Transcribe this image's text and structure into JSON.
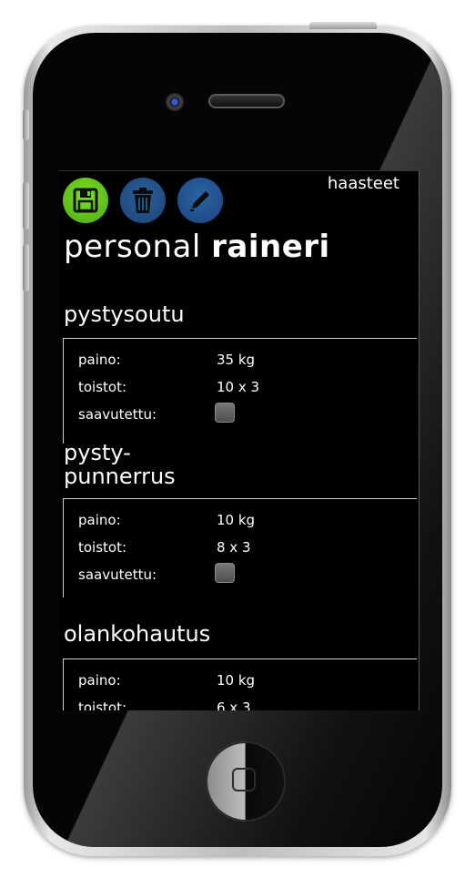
{
  "screen": {
    "top_link": "haasteet",
    "title_light": "personal",
    "title_bold": "raineri",
    "toolbar": {
      "save_icon": "floppy-disk-icon",
      "delete_icon": "trash-icon",
      "edit_icon": "pencil-icon",
      "colors": {
        "save": "#5fc41c",
        "delete": "#215487",
        "edit": "#225a96"
      }
    },
    "exercises": [
      {
        "title_line1": "pystysoutu",
        "title_line2": "",
        "weight_label": "paino:",
        "weight": "35 kg",
        "reps_label": "toistot:",
        "reps": "10 x 3",
        "achieved_label": "saavutettu:"
      },
      {
        "title_line1": "pysty-",
        "title_line2": "punnerrus",
        "weight_label": "paino:",
        "weight": "10 kg",
        "reps_label": "toistot:",
        "reps": "8 x 3",
        "achieved_label": "saavutettu:"
      },
      {
        "title_line1": "olankohautus",
        "title_line2": "",
        "weight_label": "paino:",
        "weight": "10 kg",
        "reps_label": "toistot:",
        "reps": "6 x 3"
      }
    ]
  }
}
